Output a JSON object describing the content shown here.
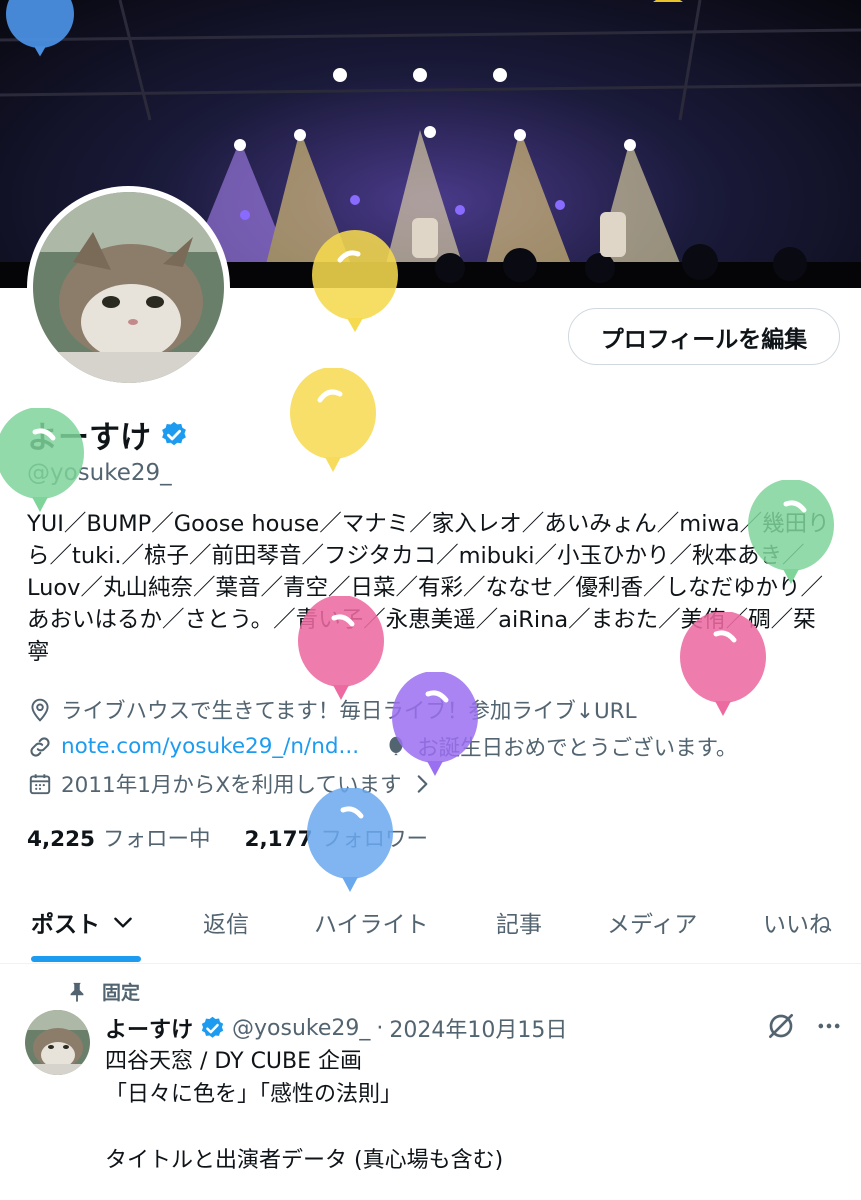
{
  "profile": {
    "display_name": "よーすけ",
    "handle": "@yosuke29_",
    "edit_profile_label": "プロフィールを編集",
    "bio": "YUI／BUMP／Goose house／マナミ／家入レオ／あいみょん／miwa／幾田りら／tuki.／椋子／前田琴音／フジタカコ／mibuki／小玉ひかり／秋本あき／Luov／丸山純奈／葉音／青空／日菜／有彩／ななせ／優利香／しなだゆかり／あおいはるか／さとう。／青い子／永恵美遥／aiRina／まおた／美侑／碉／栞寧",
    "location": "ライブハウスで生きてます！毎日ライブ！参加ライブ↓URL",
    "url": "note.com/yosuke29_/n/nd...",
    "birthday": "お誕生日おめでとうございます。",
    "joined": "2011年1月からXを利用しています",
    "following_count": "4,225",
    "following_label": "フォロー中",
    "followers_count": "2,177",
    "followers_label": "フォロワー"
  },
  "tabs": [
    {
      "label": "ポスト"
    },
    {
      "label": "返信"
    },
    {
      "label": "ハイライト"
    },
    {
      "label": "記事"
    },
    {
      "label": "メディア"
    },
    {
      "label": "いいね"
    }
  ],
  "pinned_tweet": {
    "pinned_label": "固定",
    "author_name": "よーすけ",
    "author_handle": "@yosuke29_",
    "separator": "·",
    "date": "2024年10月15日",
    "text": "四谷天窓 / DY CUBE 企画\n「日々に色を」「感性の法則」\n\nタイトルと出演者データ (真心場も含む)"
  },
  "colors": {
    "accent": "#1d9bf0",
    "balloon_yellow": "#f7dc5c",
    "balloon_green": "#7fd49a",
    "balloon_pink": "#ec6aa0",
    "balloon_purple": "#9a6ff0",
    "balloon_blue": "#6aa8ee"
  },
  "icons": [
    "location-icon",
    "link-icon",
    "balloon-icon",
    "calendar-icon",
    "chevron-right-icon",
    "chevron-down-icon",
    "pin-icon",
    "verified-icon",
    "grok-icon",
    "more-icon"
  ]
}
